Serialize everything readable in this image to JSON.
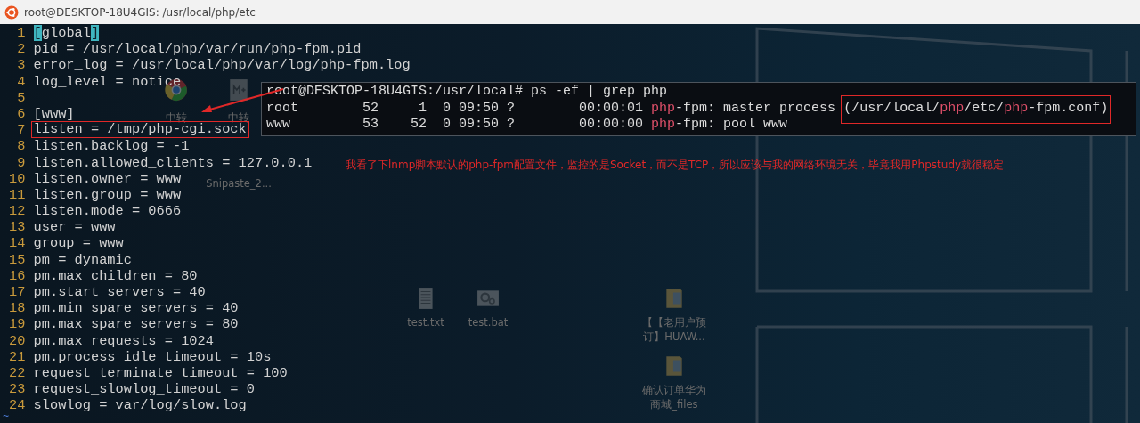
{
  "window": {
    "title": "root@DESKTOP-18U4GIS: /usr/local/php/etc"
  },
  "editor": {
    "lines": [
      {
        "number": "1",
        "boxed": false,
        "parts": [
          {
            "text": "[",
            "kind": "match"
          },
          {
            "text": "global",
            "kind": "plain"
          },
          {
            "text": "]",
            "kind": "match"
          }
        ]
      },
      {
        "number": "2",
        "boxed": false,
        "text": "pid = /usr/local/php/var/run/php-fpm.pid"
      },
      {
        "number": "3",
        "boxed": false,
        "text": "error_log = /usr/local/php/var/log/php-fpm.log"
      },
      {
        "number": "4",
        "boxed": false,
        "text": "log_level = notice"
      },
      {
        "number": "5",
        "boxed": false
      },
      {
        "number": "6",
        "boxed": false,
        "text": "[www]"
      },
      {
        "number": "7",
        "boxed": true,
        "text": "listen = /tmp/php-cgi.sock"
      },
      {
        "number": "8",
        "boxed": false,
        "text": "listen.backlog = -1"
      },
      {
        "number": "9",
        "boxed": false,
        "text": "listen.allowed_clients = 127.0.0.1"
      },
      {
        "number": "10",
        "boxed": false,
        "text": "listen.owner = www"
      },
      {
        "number": "11",
        "boxed": false,
        "text": "listen.group = www"
      },
      {
        "number": "12",
        "boxed": false,
        "text": "listen.mode = 0666"
      },
      {
        "number": "13",
        "boxed": false,
        "text": "user = www"
      },
      {
        "number": "14",
        "boxed": false,
        "text": "group = www"
      },
      {
        "number": "15",
        "boxed": false,
        "text": "pm = dynamic"
      },
      {
        "number": "16",
        "boxed": false,
        "text": "pm.max_children = 80"
      },
      {
        "number": "17",
        "boxed": false,
        "text": "pm.start_servers = 40"
      },
      {
        "number": "18",
        "boxed": false,
        "text": "pm.min_spare_servers = 40"
      },
      {
        "number": "19",
        "boxed": false,
        "text": "pm.max_spare_servers = 80"
      },
      {
        "number": "20",
        "boxed": false,
        "text": "pm.max_requests = 1024"
      },
      {
        "number": "21",
        "boxed": false,
        "text": "pm.process_idle_timeout = 10s"
      },
      {
        "number": "22",
        "boxed": false,
        "text": "request_terminate_timeout = 100"
      },
      {
        "number": "23",
        "boxed": false,
        "text": "request_slowlog_timeout = 0"
      },
      {
        "number": "24",
        "boxed": false,
        "text": "slowlog = var/log/slow.log"
      }
    ],
    "filler": "~"
  },
  "inset_terminal": {
    "lines": [
      {
        "parts": [
          {
            "kind": "plain",
            "text": "root@DESKTOP-18U4GIS:/usr/local# ps -ef | grep php"
          }
        ]
      },
      {
        "parts": [
          {
            "kind": "plain",
            "text": "root        52     1  0 09:50 ?        00:00:01 "
          },
          {
            "kind": "match",
            "text": "php"
          },
          {
            "kind": "plain",
            "text": "-fpm: master process "
          },
          {
            "kind": "boxed",
            "parts": [
              {
                "kind": "plain",
                "text": "(/usr/local/"
              },
              {
                "kind": "match",
                "text": "php"
              },
              {
                "kind": "plain",
                "text": "/etc/"
              },
              {
                "kind": "match",
                "text": "php"
              },
              {
                "kind": "plain",
                "text": "-fpm.conf)"
              }
            ]
          }
        ]
      },
      {
        "parts": [
          {
            "kind": "plain",
            "text": "www         53    52  0 09:50 ?        00:00:00 "
          },
          {
            "kind": "match",
            "text": "php"
          },
          {
            "kind": "plain",
            "text": "-fpm: pool www"
          }
        ]
      }
    ]
  },
  "annotation": {
    "text": "我看了下lnmp脚本默认的php-fpm配置文件，监控的是Socket，而不是TCP，所以应该与我的网络环境无关，毕竟我用Phpstudy就很稳定"
  },
  "desktop": {
    "icons": [
      {
        "kind": "browser",
        "label": "中转"
      },
      {
        "kind": "markdown",
        "label": "中转"
      },
      {
        "kind": "none",
        "label": "Snipaste_2..."
      },
      {
        "kind": "text",
        "label": "test.txt"
      },
      {
        "kind": "batch",
        "label": "test.bat"
      },
      {
        "kind": "folder",
        "label": "【【老用户预订】HUAW..."
      },
      {
        "kind": "folder",
        "label": "确认订单华为商城_files"
      }
    ]
  }
}
